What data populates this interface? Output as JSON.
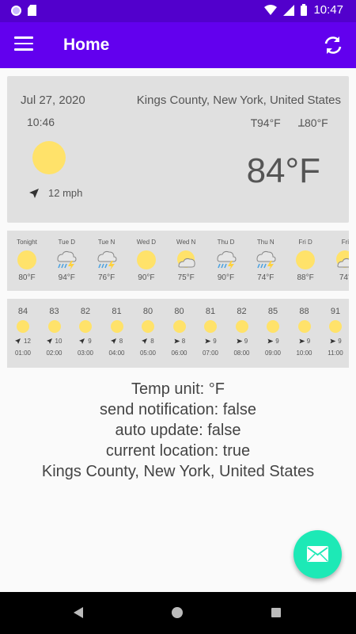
{
  "status_bar": {
    "time": "10:47"
  },
  "app_bar": {
    "title": "Home"
  },
  "current": {
    "date": "Jul 27, 2020",
    "location": "Kings County, New York, United States",
    "time": "10:46",
    "high": "94°F",
    "low": "80°F",
    "wind": "12 mph",
    "temperature": "84°F"
  },
  "daily": [
    {
      "label": "Tonight",
      "temp": "80°F",
      "icon": "sun-icon"
    },
    {
      "label": "Tue D",
      "temp": "94°F",
      "icon": "thunderstorm-icon"
    },
    {
      "label": "Tue N",
      "temp": "76°F",
      "icon": "thunderstorm-icon"
    },
    {
      "label": "Wed D",
      "temp": "90°F",
      "icon": "sun-icon"
    },
    {
      "label": "Wed N",
      "temp": "75°F",
      "icon": "partly-cloudy-icon"
    },
    {
      "label": "Thu D",
      "temp": "90°F",
      "icon": "thunderstorm-icon"
    },
    {
      "label": "Thu N",
      "temp": "74°F",
      "icon": "thunderstorm-icon"
    },
    {
      "label": "Fri D",
      "temp": "88°F",
      "icon": "sun-icon"
    },
    {
      "label": "Fri",
      "temp": "74°",
      "icon": "partly-cloudy-icon"
    }
  ],
  "hourly": [
    {
      "temp": "84",
      "wind": "12",
      "hour": "01:00"
    },
    {
      "temp": "83",
      "wind": "10",
      "hour": "02:00"
    },
    {
      "temp": "82",
      "wind": "9",
      "hour": "03:00"
    },
    {
      "temp": "81",
      "wind": "8",
      "hour": "04:00"
    },
    {
      "temp": "80",
      "wind": "8",
      "hour": "05:00"
    },
    {
      "temp": "80",
      "wind": "8",
      "hour": "06:00"
    },
    {
      "temp": "81",
      "wind": "9",
      "hour": "07:00"
    },
    {
      "temp": "82",
      "wind": "9",
      "hour": "08:00"
    },
    {
      "temp": "85",
      "wind": "9",
      "hour": "09:00"
    },
    {
      "temp": "88",
      "wind": "9",
      "hour": "10:00"
    },
    {
      "temp": "91",
      "wind": "9",
      "hour": "11:00"
    }
  ],
  "settings": {
    "temp_unit": "Temp unit: °F",
    "send_notification": "send notification: false",
    "auto_update": "auto update: false",
    "current_location": "current location: true",
    "location": "Kings County, New York, United States"
  },
  "colors": {
    "status_bar": "#5200cc",
    "app_bar": "#6200ee",
    "fab": "#1de9b6",
    "sun": "#ffe26a"
  }
}
